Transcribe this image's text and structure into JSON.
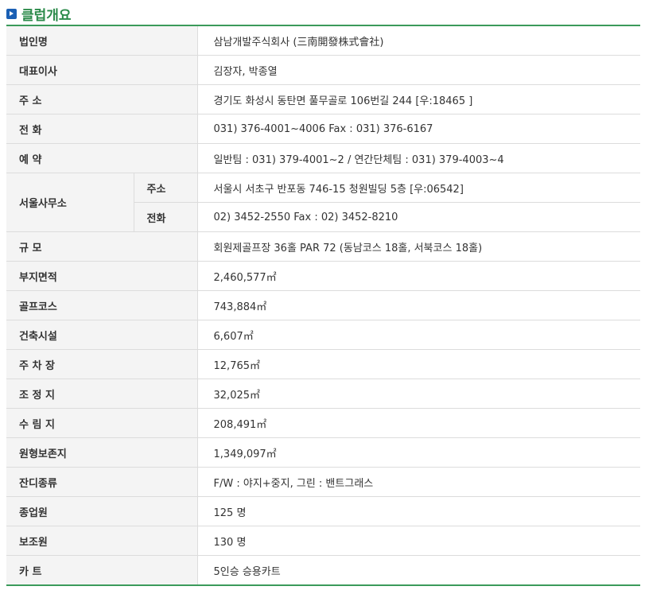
{
  "section": {
    "title": "클럽개요",
    "icon": "arrow-right-icon",
    "accent": "#2b8a4a",
    "icon_color": "#1a5fb4"
  },
  "rows": {
    "corp": {
      "label": "법인명",
      "value": "삼남개발주식회사 (三南開發株式會社)"
    },
    "ceo": {
      "label": "대표이사",
      "value": "김장자, 박종열"
    },
    "address": {
      "label": "주 소",
      "value": "경기도 화성시 동탄면 풀무골로 106번길 244 [우:18465 ]"
    },
    "phone": {
      "label": "전 화",
      "value": "031) 376-4001~4006 Fax : 031) 376-6167"
    },
    "reservation": {
      "label": "예 약",
      "value": "일반팀 : 031) 379-4001~2 / 연간단체팀 : 031) 379-4003~4"
    },
    "seoul_office": {
      "label": "서울사무소",
      "address_label": "주소",
      "address_value": "서울시 서초구 반포동 746-15 청원빌딩 5층 [우:06542]",
      "phone_label": "전화",
      "phone_value": "02) 3452-2550 Fax : 02) 3452-8210"
    },
    "scale": {
      "label": "규 모",
      "value": "회원제골프장 36홀 PAR 72 (동남코스 18홀, 서북코스 18홀)"
    },
    "site_area": {
      "label": "부지면적",
      "value": "2,460,577㎡"
    },
    "golf_course": {
      "label": "골프코스",
      "value": "743,884㎡"
    },
    "building": {
      "label": "건축시설",
      "value": "6,607㎡"
    },
    "parking": {
      "label": "주 차 장",
      "value": "12,765㎡"
    },
    "landscaping": {
      "label": "조 정 지",
      "value": "32,025㎡"
    },
    "forest": {
      "label": "수 림 지",
      "value": "208,491㎡"
    },
    "preserved": {
      "label": "원형보존지",
      "value": "1,349,097㎡"
    },
    "turf": {
      "label": "잔디종류",
      "value": "F/W : 야지+중지, 그린 : 밴트그래스"
    },
    "staff": {
      "label": "종업원",
      "value": "125 명"
    },
    "caddies": {
      "label": "보조원",
      "value": "130 명"
    },
    "cart": {
      "label": "카 트",
      "value": "5인승 승용카트"
    }
  }
}
